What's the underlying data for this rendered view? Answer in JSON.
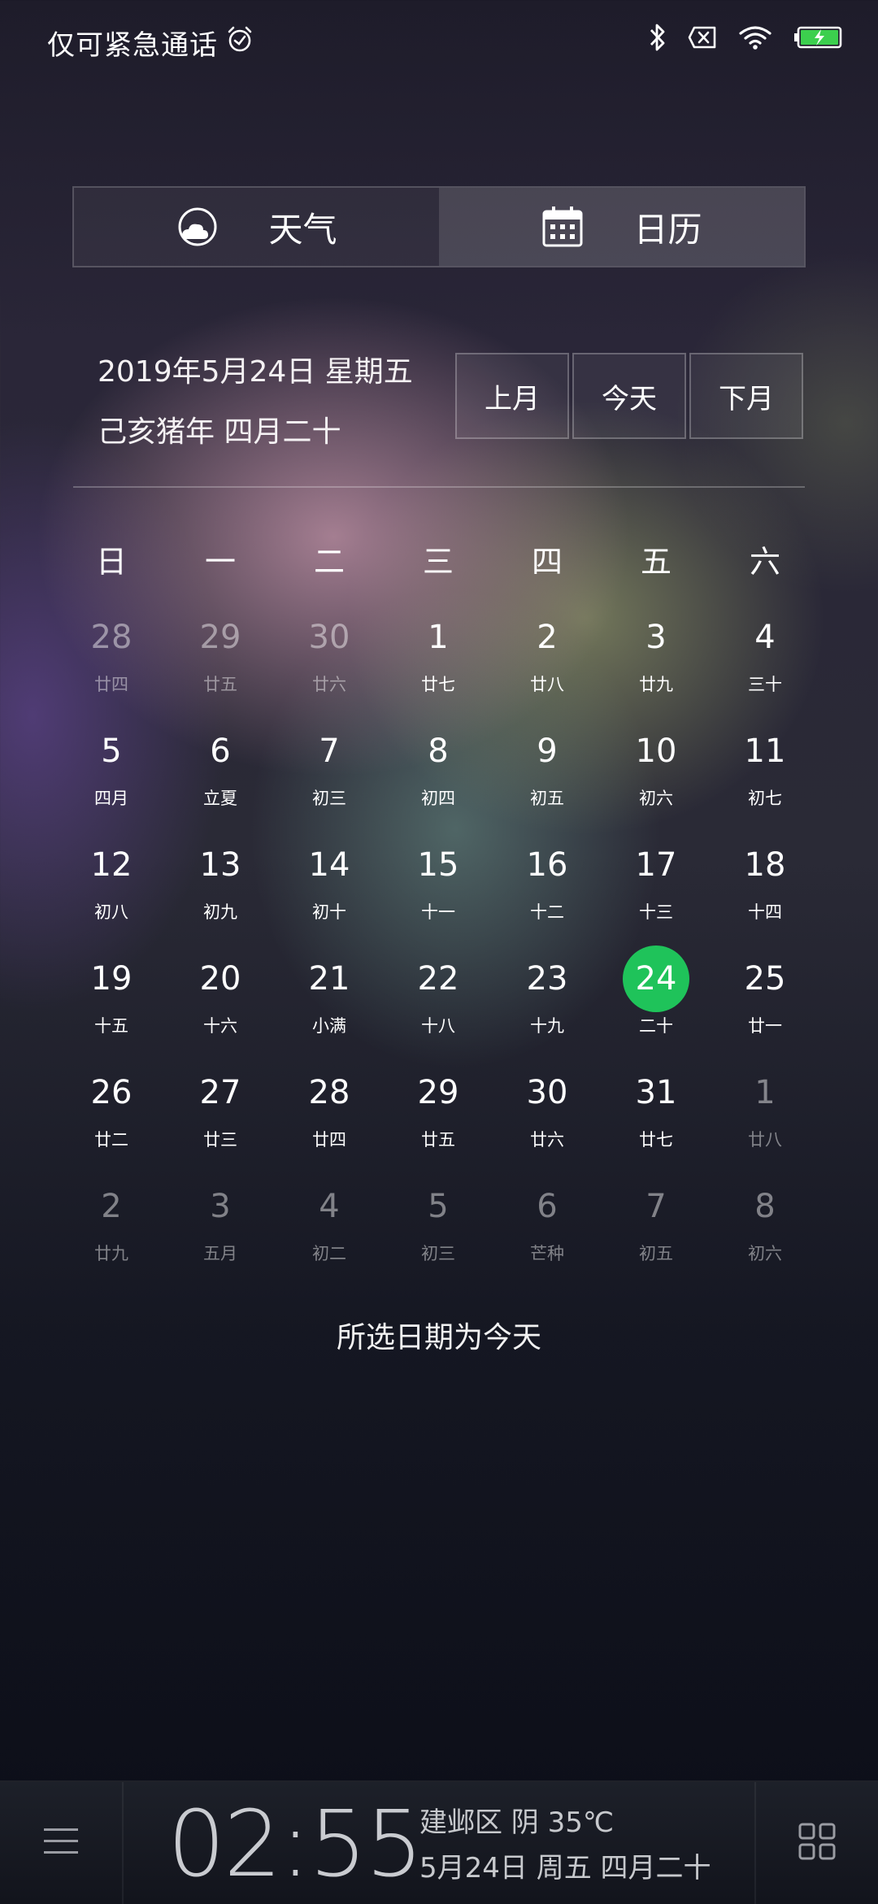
{
  "status_bar": {
    "left_text": "仅可紧急通话",
    "icons": [
      "alarm-icon",
      "bluetooth-icon",
      "no-sim-icon",
      "wifi-icon",
      "battery-charging-icon"
    ]
  },
  "tabs": [
    {
      "label": "天气",
      "icon": "weather-cloud-icon"
    },
    {
      "label": "日历",
      "icon": "calendar-icon",
      "active": true
    }
  ],
  "date_info": {
    "solar": "2019年5月24日 星期五",
    "lunar": "己亥猪年 四月二十"
  },
  "nav_buttons": {
    "prev": "上月",
    "today": "今天",
    "next": "下月"
  },
  "calendar": {
    "weekdays": [
      "日",
      "一",
      "二",
      "三",
      "四",
      "五",
      "六"
    ],
    "days": [
      {
        "num": "28",
        "lunar": "廿四",
        "dim": true
      },
      {
        "num": "29",
        "lunar": "廿五",
        "dim": true
      },
      {
        "num": "30",
        "lunar": "廿六",
        "dim": true
      },
      {
        "num": "1",
        "lunar": "廿七"
      },
      {
        "num": "2",
        "lunar": "廿八"
      },
      {
        "num": "3",
        "lunar": "廿九"
      },
      {
        "num": "4",
        "lunar": "三十"
      },
      {
        "num": "5",
        "lunar": "四月"
      },
      {
        "num": "6",
        "lunar": "立夏"
      },
      {
        "num": "7",
        "lunar": "初三"
      },
      {
        "num": "8",
        "lunar": "初四"
      },
      {
        "num": "9",
        "lunar": "初五"
      },
      {
        "num": "10",
        "lunar": "初六"
      },
      {
        "num": "11",
        "lunar": "初七"
      },
      {
        "num": "12",
        "lunar": "初八"
      },
      {
        "num": "13",
        "lunar": "初九"
      },
      {
        "num": "14",
        "lunar": "初十"
      },
      {
        "num": "15",
        "lunar": "十一"
      },
      {
        "num": "16",
        "lunar": "十二"
      },
      {
        "num": "17",
        "lunar": "十三"
      },
      {
        "num": "18",
        "lunar": "十四"
      },
      {
        "num": "19",
        "lunar": "十五"
      },
      {
        "num": "20",
        "lunar": "十六"
      },
      {
        "num": "21",
        "lunar": "小满"
      },
      {
        "num": "22",
        "lunar": "十八"
      },
      {
        "num": "23",
        "lunar": "十九"
      },
      {
        "num": "24",
        "lunar": "二十",
        "today": true
      },
      {
        "num": "25",
        "lunar": "廿一"
      },
      {
        "num": "26",
        "lunar": "廿二"
      },
      {
        "num": "27",
        "lunar": "廿三"
      },
      {
        "num": "28",
        "lunar": "廿四"
      },
      {
        "num": "29",
        "lunar": "廿五"
      },
      {
        "num": "30",
        "lunar": "廿六"
      },
      {
        "num": "31",
        "lunar": "廿七"
      },
      {
        "num": "1",
        "lunar": "廿八",
        "dim": true
      },
      {
        "num": "2",
        "lunar": "廿九",
        "dim": true
      },
      {
        "num": "3",
        "lunar": "五月",
        "dim": true
      },
      {
        "num": "4",
        "lunar": "初二",
        "dim": true
      },
      {
        "num": "5",
        "lunar": "初三",
        "dim": true
      },
      {
        "num": "6",
        "lunar": "芒种",
        "dim": true
      },
      {
        "num": "7",
        "lunar": "初五",
        "dim": true
      },
      {
        "num": "8",
        "lunar": "初六",
        "dim": true
      }
    ],
    "today_color": "#1fc35a"
  },
  "selected_message": "所选日期为今天",
  "dock": {
    "time": "02:55",
    "weather": "建邺区 阴 35℃",
    "date": "5月24日 周五 四月二十",
    "left_icon": "menu-icon",
    "right_icon": "apps-grid-icon"
  }
}
